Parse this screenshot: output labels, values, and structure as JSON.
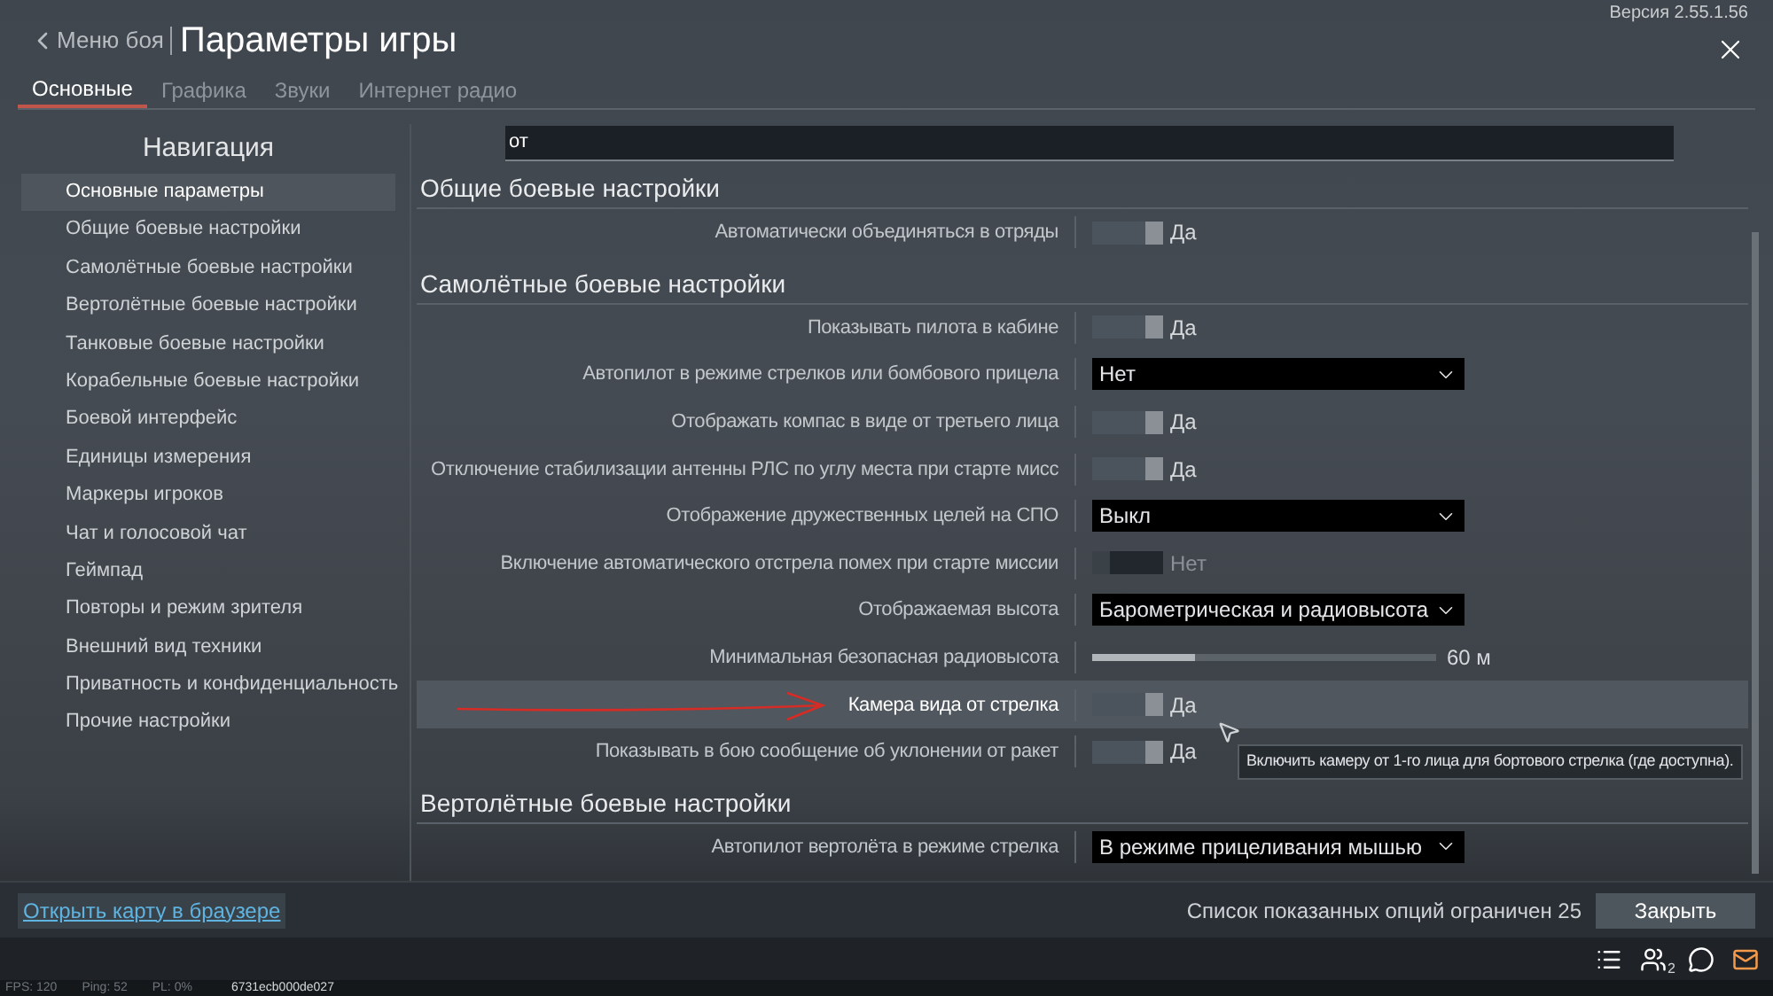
{
  "header": {
    "back_label": "Меню боя",
    "title": "Параметры игры",
    "version": "Версия 2.55.1.56"
  },
  "tabs": [
    {
      "label": "Основные",
      "selected": true
    },
    {
      "label": "Графика",
      "selected": false
    },
    {
      "label": "Звуки",
      "selected": false
    },
    {
      "label": "Интернет радио",
      "selected": false
    }
  ],
  "navigation": {
    "title": "Навигация",
    "items": [
      {
        "label": "Основные параметры",
        "selected": true
      },
      {
        "label": "Общие боевые настройки",
        "selected": false
      },
      {
        "label": "Самолётные боевые настройки",
        "selected": false
      },
      {
        "label": "Вертолётные боевые настройки",
        "selected": false
      },
      {
        "label": "Танковые боевые настройки",
        "selected": false
      },
      {
        "label": "Корабельные боевые настройки",
        "selected": false
      },
      {
        "label": "Боевой интерфейс",
        "selected": false
      },
      {
        "label": "Единицы измерения",
        "selected": false
      },
      {
        "label": "Маркеры игроков",
        "selected": false
      },
      {
        "label": "Чат и голосовой чат",
        "selected": false
      },
      {
        "label": "Геймпад",
        "selected": false
      },
      {
        "label": "Повторы и режим зрителя",
        "selected": false
      },
      {
        "label": "Внешний вид техники",
        "selected": false
      },
      {
        "label": "Приватность и конфиденциальность",
        "selected": false
      },
      {
        "label": "Прочие настройки",
        "selected": false
      }
    ]
  },
  "search": {
    "value": "от"
  },
  "sections": [
    {
      "title": "Общие боевые настройки",
      "rows": [
        {
          "kind": "toggle",
          "label": "Автоматически объединяться в отряды",
          "on": true,
          "value": "Да",
          "highlighted": false
        }
      ]
    },
    {
      "title": "Самолётные боевые настройки",
      "rows": [
        {
          "kind": "toggle",
          "label": "Показывать пилота в кабине",
          "on": true,
          "value": "Да",
          "highlighted": false
        },
        {
          "kind": "dropdown",
          "label": "Автопилот в режиме стрелков или бомбового прицела",
          "value": "Нет",
          "highlighted": false
        },
        {
          "kind": "toggle",
          "label": "Отображать компас в виде от третьего лица",
          "on": true,
          "value": "Да",
          "highlighted": false
        },
        {
          "kind": "toggle",
          "label": "Отключение стабилизации антенны РЛС по углу места при старте мисс",
          "on": true,
          "value": "Да",
          "highlighted": false
        },
        {
          "kind": "dropdown",
          "label": "Отображение дружественных целей на СПО",
          "value": "Выкл",
          "highlighted": false
        },
        {
          "kind": "toggle",
          "label": "Включение автоматического отстрела помех при старте миссии",
          "on": false,
          "value": "Нет",
          "highlighted": false
        },
        {
          "kind": "dropdown",
          "label": "Отображаемая высота",
          "value": "Барометрическая и радиовысота",
          "highlighted": false
        },
        {
          "kind": "slider",
          "label": "Минимальная безопасная радиовысота",
          "level": 0.3,
          "value": "60 м",
          "highlighted": false
        },
        {
          "kind": "toggle",
          "label": "Камера вида от стрелка",
          "on": true,
          "value": "Да",
          "highlighted": true
        },
        {
          "kind": "toggle",
          "label": "Показывать в бою сообщение об уклонении от ракет",
          "on": true,
          "value": "Да",
          "highlighted": false
        }
      ]
    },
    {
      "title": "Вертолётные боевые настройки",
      "rows": [
        {
          "kind": "dropdown",
          "label": "Автопилот вертолёта в режиме стрелка",
          "value": "В режиме прицеливания мышью",
          "highlighted": false
        }
      ]
    }
  ],
  "tooltip": "Включить камеру от 1-го лица для бортового стрелка (где доступна).",
  "footer": {
    "link": "Открыть карту в браузере",
    "limit_text": "Список показанных опций ограничен 25",
    "close_button": "Закрыть"
  },
  "taskbar": {
    "friends_badge": "2"
  },
  "status_line": [
    "FPS: 120",
    "Ping: 52",
    "PL: 0%",
    "6731ecb000de027"
  ]
}
